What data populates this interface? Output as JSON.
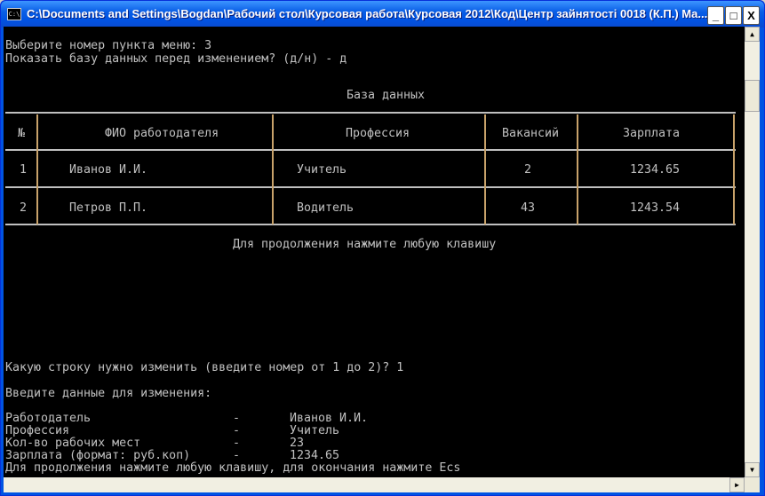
{
  "window": {
    "title": "C:\\Documents and Settings\\Bogdan\\Рабочий стол\\Курсовая работа\\Курсовая 2012\\Код\\Центр зайнятості 0018 (К.П.) Ma...",
    "icon": "console-icon",
    "minimize": "_",
    "maximize": "□",
    "close": "X"
  },
  "console": {
    "prompt1": "Выберите номер пункта меню: 3",
    "prompt2": "Показать базу данных перед изменением? (д/н) - д",
    "table_title": "База данных",
    "headers": [
      "№",
      "ФИО работодателя",
      "Профессия",
      "Вакансий",
      "Зарплата"
    ],
    "rows": [
      {
        "n": "1",
        "name": "Иванов И.И.",
        "prof": "Учитель",
        "vac": "2",
        "salary": "1234.65"
      },
      {
        "n": "2",
        "name": "Петров П.П.",
        "prof": "Водитель",
        "vac": "43",
        "salary": "1243.54"
      }
    ],
    "continue1": "Для продолжения нажмите любую клавишу",
    "which_row": "Какую строку нужно изменить (введите номер от 1 до 2)? 1",
    "enter_data": "Введите данные для изменения:",
    "fields": [
      {
        "label": "Работодатель",
        "dash": "-",
        "value": "Иванов И.И."
      },
      {
        "label": "Профессия",
        "dash": "-",
        "value": "Учитель"
      },
      {
        "label": "Кол-во рабочих мест",
        "dash": "-",
        "value": "23"
      },
      {
        "label": "Зарплата (формат: руб.коп)",
        "dash": "-",
        "value": "1234.65"
      }
    ],
    "continue2": "Для продолжения нажмите любую клавишу, для окончания нажмите Ecs"
  }
}
